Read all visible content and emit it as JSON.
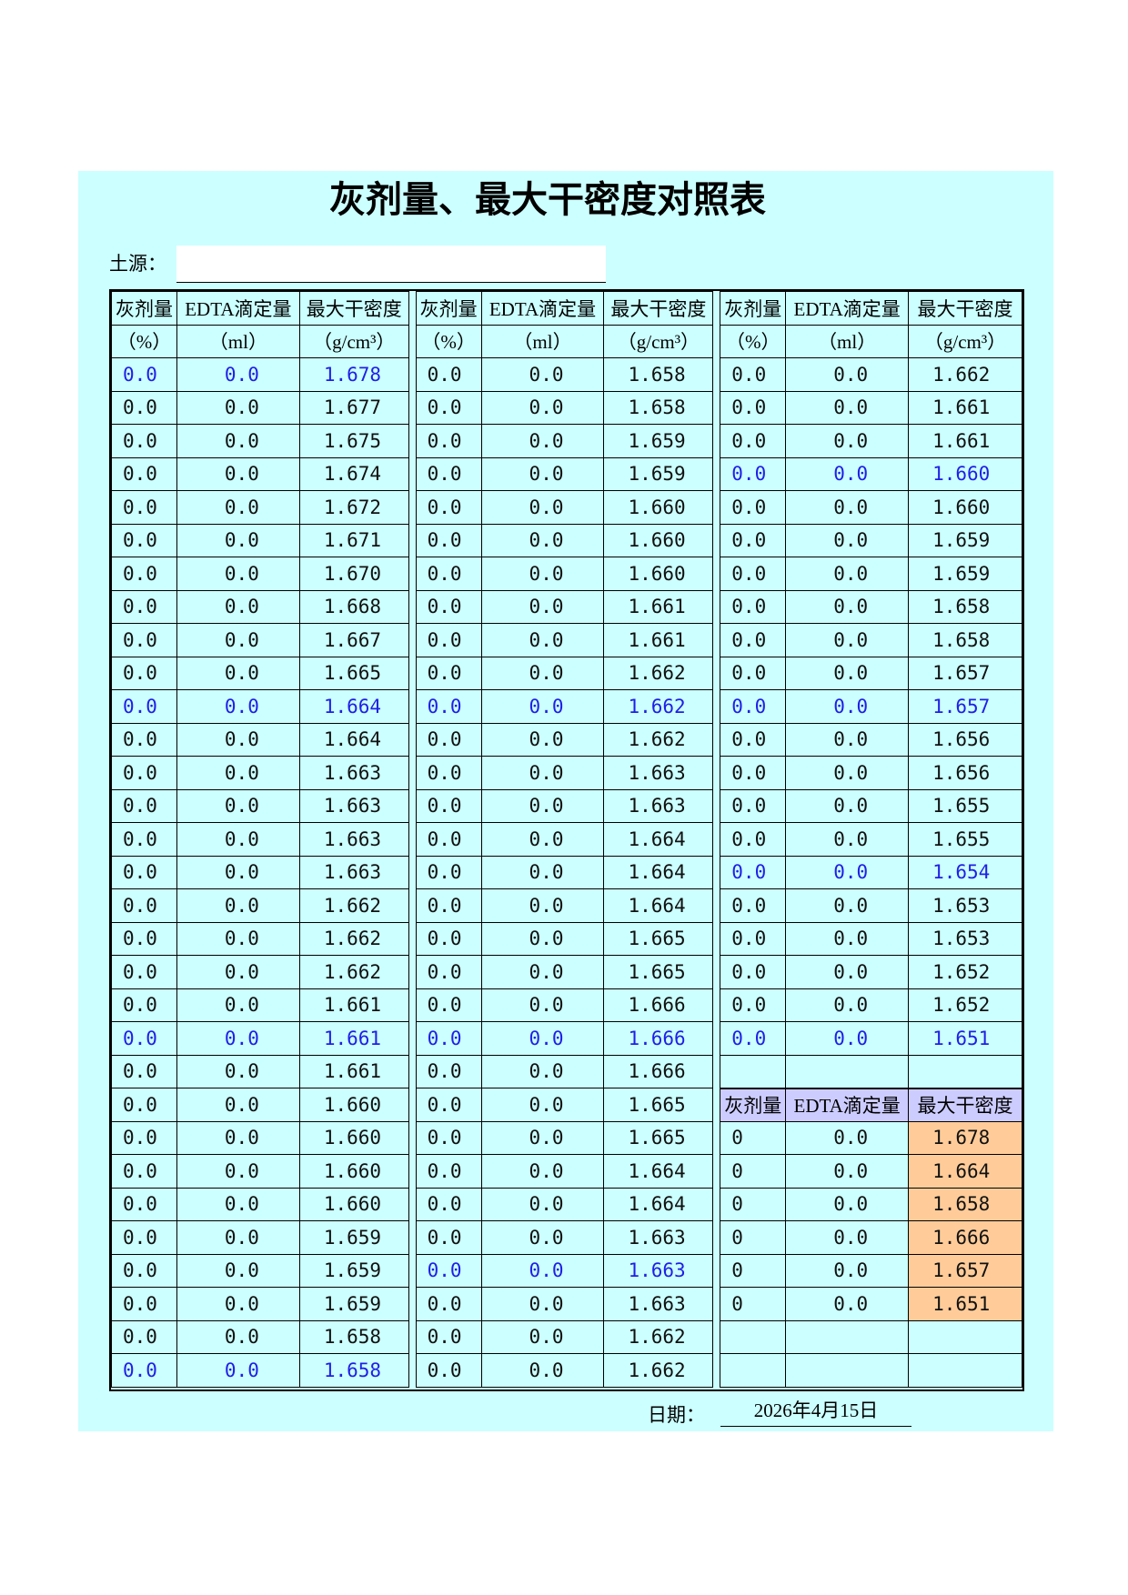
{
  "title": "灰剂量、最大干密度对照表",
  "soil_source": {
    "label": "土源：",
    "value": ""
  },
  "headers": {
    "col1_line1": "灰剂量",
    "col2_line1": "EDTA滴定量",
    "col3_line1": "最大干密度",
    "col1_line2": "（%）",
    "col2_line2": "（ml）",
    "col3_line2": "（g/cm³）"
  },
  "table1": {
    "rows": [
      [
        "0.0",
        "0.0",
        "1.678",
        true
      ],
      [
        "0.0",
        "0.0",
        "1.677",
        false
      ],
      [
        "0.0",
        "0.0",
        "1.675",
        false
      ],
      [
        "0.0",
        "0.0",
        "1.674",
        false
      ],
      [
        "0.0",
        "0.0",
        "1.672",
        false
      ],
      [
        "0.0",
        "0.0",
        "1.671",
        false
      ],
      [
        "0.0",
        "0.0",
        "1.670",
        false
      ],
      [
        "0.0",
        "0.0",
        "1.668",
        false
      ],
      [
        "0.0",
        "0.0",
        "1.667",
        false
      ],
      [
        "0.0",
        "0.0",
        "1.665",
        false
      ],
      [
        "0.0",
        "0.0",
        "1.664",
        true
      ],
      [
        "0.0",
        "0.0",
        "1.664",
        false
      ],
      [
        "0.0",
        "0.0",
        "1.663",
        false
      ],
      [
        "0.0",
        "0.0",
        "1.663",
        false
      ],
      [
        "0.0",
        "0.0",
        "1.663",
        false
      ],
      [
        "0.0",
        "0.0",
        "1.663",
        false
      ],
      [
        "0.0",
        "0.0",
        "1.662",
        false
      ],
      [
        "0.0",
        "0.0",
        "1.662",
        false
      ],
      [
        "0.0",
        "0.0",
        "1.662",
        false
      ],
      [
        "0.0",
        "0.0",
        "1.661",
        false
      ],
      [
        "0.0",
        "0.0",
        "1.661",
        true
      ],
      [
        "0.0",
        "0.0",
        "1.661",
        false
      ],
      [
        "0.0",
        "0.0",
        "1.660",
        false
      ],
      [
        "0.0",
        "0.0",
        "1.660",
        false
      ],
      [
        "0.0",
        "0.0",
        "1.660",
        false
      ],
      [
        "0.0",
        "0.0",
        "1.660",
        false
      ],
      [
        "0.0",
        "0.0",
        "1.659",
        false
      ],
      [
        "0.0",
        "0.0",
        "1.659",
        false
      ],
      [
        "0.0",
        "0.0",
        "1.659",
        false
      ],
      [
        "0.0",
        "0.0",
        "1.658",
        false
      ],
      [
        "0.0",
        "0.0",
        "1.658",
        true
      ]
    ]
  },
  "table2": {
    "rows": [
      [
        "0.0",
        "0.0",
        "1.658",
        false
      ],
      [
        "0.0",
        "0.0",
        "1.658",
        false
      ],
      [
        "0.0",
        "0.0",
        "1.659",
        false
      ],
      [
        "0.0",
        "0.0",
        "1.659",
        false
      ],
      [
        "0.0",
        "0.0",
        "1.660",
        false
      ],
      [
        "0.0",
        "0.0",
        "1.660",
        false
      ],
      [
        "0.0",
        "0.0",
        "1.660",
        false
      ],
      [
        "0.0",
        "0.0",
        "1.661",
        false
      ],
      [
        "0.0",
        "0.0",
        "1.661",
        false
      ],
      [
        "0.0",
        "0.0",
        "1.662",
        false
      ],
      [
        "0.0",
        "0.0",
        "1.662",
        true
      ],
      [
        "0.0",
        "0.0",
        "1.662",
        false
      ],
      [
        "0.0",
        "0.0",
        "1.663",
        false
      ],
      [
        "0.0",
        "0.0",
        "1.663",
        false
      ],
      [
        "0.0",
        "0.0",
        "1.664",
        false
      ],
      [
        "0.0",
        "0.0",
        "1.664",
        false
      ],
      [
        "0.0",
        "0.0",
        "1.664",
        false
      ],
      [
        "0.0",
        "0.0",
        "1.665",
        false
      ],
      [
        "0.0",
        "0.0",
        "1.665",
        false
      ],
      [
        "0.0",
        "0.0",
        "1.666",
        false
      ],
      [
        "0.0",
        "0.0",
        "1.666",
        true
      ],
      [
        "0.0",
        "0.0",
        "1.666",
        false
      ],
      [
        "0.0",
        "0.0",
        "1.665",
        false
      ],
      [
        "0.0",
        "0.0",
        "1.665",
        false
      ],
      [
        "0.0",
        "0.0",
        "1.664",
        false
      ],
      [
        "0.0",
        "0.0",
        "1.664",
        false
      ],
      [
        "0.0",
        "0.0",
        "1.663",
        false
      ],
      [
        "0.0",
        "0.0",
        "1.663",
        true
      ],
      [
        "0.0",
        "0.0",
        "1.663",
        false
      ],
      [
        "0.0",
        "0.0",
        "1.662",
        false
      ],
      [
        "0.0",
        "0.0",
        "1.662",
        false
      ]
    ]
  },
  "table3": {
    "rows": [
      [
        "0.0",
        "0.0",
        "1.662",
        false
      ],
      [
        "0.0",
        "0.0",
        "1.661",
        false
      ],
      [
        "0.0",
        "0.0",
        "1.661",
        false
      ],
      [
        "0.0",
        "0.0",
        "1.660",
        true
      ],
      [
        "0.0",
        "0.0",
        "1.660",
        false
      ],
      [
        "0.0",
        "0.0",
        "1.659",
        false
      ],
      [
        "0.0",
        "0.0",
        "1.659",
        false
      ],
      [
        "0.0",
        "0.0",
        "1.658",
        false
      ],
      [
        "0.0",
        "0.0",
        "1.658",
        false
      ],
      [
        "0.0",
        "0.0",
        "1.657",
        false
      ],
      [
        "0.0",
        "0.0",
        "1.657",
        true
      ],
      [
        "0.0",
        "0.0",
        "1.656",
        false
      ],
      [
        "0.0",
        "0.0",
        "1.656",
        false
      ],
      [
        "0.0",
        "0.0",
        "1.655",
        false
      ],
      [
        "0.0",
        "0.0",
        "1.655",
        false
      ],
      [
        "0.0",
        "0.0",
        "1.654",
        true
      ],
      [
        "0.0",
        "0.0",
        "1.653",
        false
      ],
      [
        "0.0",
        "0.0",
        "1.653",
        false
      ],
      [
        "0.0",
        "0.0",
        "1.652",
        false
      ],
      [
        "0.0",
        "0.0",
        "1.652",
        false
      ],
      [
        "0.0",
        "0.0",
        "1.651",
        true
      ]
    ]
  },
  "summary": {
    "headers": [
      "灰剂量",
      "EDTA滴定量",
      "最大干密度"
    ],
    "rows": [
      [
        "0",
        "0.0",
        "1.678"
      ],
      [
        "0",
        "0.0",
        "1.664"
      ],
      [
        "0",
        "0.0",
        "1.658"
      ],
      [
        "0",
        "0.0",
        "1.666"
      ],
      [
        "0",
        "0.0",
        "1.657"
      ],
      [
        "0",
        "0.0",
        "1.651"
      ]
    ]
  },
  "date": {
    "label": "日期：",
    "value": "2026年4月15日"
  },
  "colors": {
    "sheet_bg": "#ccffff",
    "highlight_text": "#1f1fe6",
    "summary_header_bg": "#ccccff",
    "summary_value_bg": "#ffcc99"
  }
}
